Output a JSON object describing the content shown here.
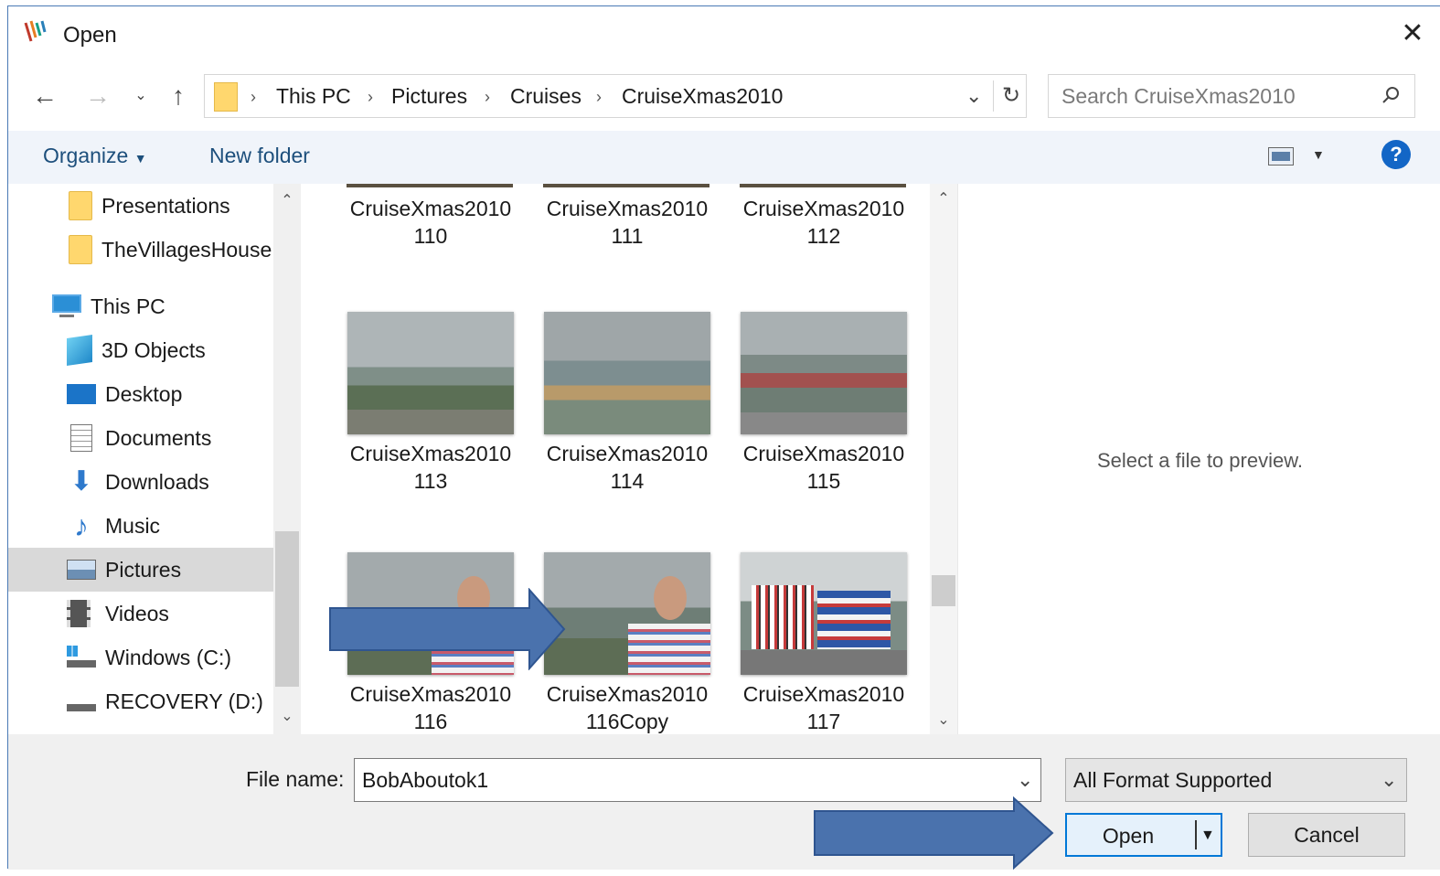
{
  "window": {
    "title": "Open",
    "close_icon": "close-icon",
    "app_icon": "app-logo-icon"
  },
  "nav": {
    "back_icon": "back-arrow-icon",
    "forward_icon": "forward-arrow-icon",
    "recent_icon": "chevron-down-icon",
    "up_icon": "up-arrow-icon",
    "breadcrumb": [
      "This PC",
      "Pictures",
      "Cruises",
      "CruiseXmas2010"
    ],
    "refresh_icon": "refresh-icon",
    "search_placeholder": "Search CruiseXmas2010"
  },
  "toolbar": {
    "organize_label": "Organize",
    "new_folder_label": "New folder",
    "help_label": "?"
  },
  "sidebar": {
    "items": [
      {
        "label": "Presentations",
        "icon": "folder-icon",
        "indent": true
      },
      {
        "label": "TheVillagesHouse",
        "icon": "folder-icon",
        "indent": true
      },
      {
        "label": "This PC",
        "icon": "computer-icon",
        "indent": false
      },
      {
        "label": "3D Objects",
        "icon": "3d-objects-icon",
        "indent": true
      },
      {
        "label": "Desktop",
        "icon": "desktop-icon",
        "indent": true
      },
      {
        "label": "Documents",
        "icon": "documents-icon",
        "indent": true
      },
      {
        "label": "Downloads",
        "icon": "downloads-icon",
        "indent": true
      },
      {
        "label": "Music",
        "icon": "music-icon",
        "indent": true
      },
      {
        "label": "Pictures",
        "icon": "pictures-icon",
        "indent": true,
        "selected": true
      },
      {
        "label": "Videos",
        "icon": "videos-icon",
        "indent": true
      },
      {
        "label": "Windows (C:)",
        "icon": "drive-c-icon",
        "indent": true
      },
      {
        "label": "RECOVERY (D:)",
        "icon": "drive-d-icon",
        "indent": true
      }
    ]
  },
  "files": [
    {
      "line1": "CruiseXmas2010",
      "line2": "110"
    },
    {
      "line1": "CruiseXmas2010",
      "line2": "111"
    },
    {
      "line1": "CruiseXmas2010",
      "line2": "112"
    },
    {
      "line1": "CruiseXmas2010",
      "line2": "113"
    },
    {
      "line1": "CruiseXmas2010",
      "line2": "114"
    },
    {
      "line1": "CruiseXmas2010",
      "line2": "115"
    },
    {
      "line1": "CruiseXmas2010",
      "line2": "116"
    },
    {
      "line1": "CruiseXmas2010",
      "line2": "116Copy"
    },
    {
      "line1": "CruiseXmas2010",
      "line2": "117"
    }
  ],
  "preview": {
    "text": "Select a file to preview."
  },
  "bottom": {
    "file_name_label": "File name:",
    "file_name_value": "BobAboutok1",
    "file_type": "All Format Supported",
    "open_label": "Open",
    "cancel_label": "Cancel"
  },
  "colors": {
    "accent": "#0078d7",
    "annotation_arrow": "#4a72ad",
    "help_blue": "#1366c6"
  }
}
